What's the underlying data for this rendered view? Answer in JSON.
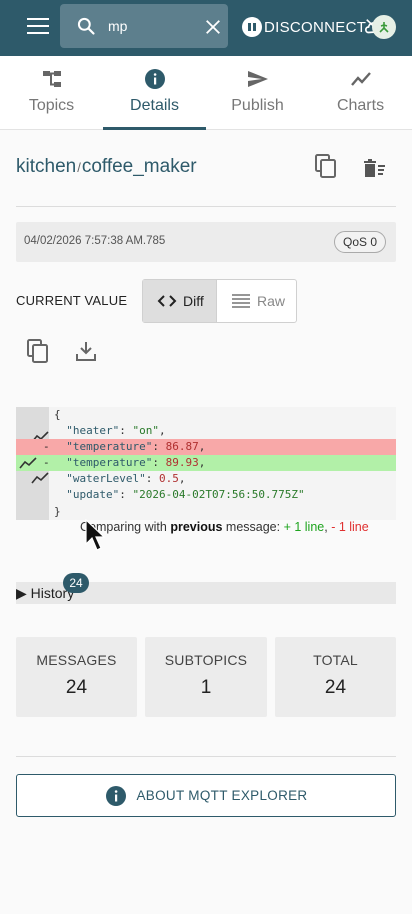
{
  "appbar": {
    "search_value": "mp",
    "disconnect_label": "DISCONNECT"
  },
  "tabs": [
    {
      "label": "Topics",
      "icon": "topics-tree-icon"
    },
    {
      "label": "Details",
      "icon": "info-icon",
      "active": true
    },
    {
      "label": "Publish",
      "icon": "send-icon"
    },
    {
      "label": "Charts",
      "icon": "chart-line-icon"
    }
  ],
  "topic": {
    "parent": "kitchen",
    "separator": "/",
    "name": "coffee_maker"
  },
  "message": {
    "timestamp": "04/02/2026 7:57:38 AM.785",
    "qos": "QoS 0"
  },
  "value": {
    "label": "CURRENT VALUE",
    "diff_label": "Diff",
    "raw_label": "Raw",
    "open_brace": "{",
    "close_brace": "}",
    "lines": [
      {
        "key": "\"heater\"",
        "value": "\"on\"",
        "kind": "string",
        "trail": ","
      },
      {
        "key": "\"temperature\"",
        "value": "86.87",
        "kind": "number",
        "trail": ",",
        "change": "removed"
      },
      {
        "key": "\"temperature\"",
        "value": "89.93",
        "kind": "number",
        "trail": ",",
        "change": "added"
      },
      {
        "key": "\"waterLevel\"",
        "value": "0.5",
        "kind": "number",
        "trail": ","
      },
      {
        "key": "\"update\"",
        "value": "\"2026-04-02T07:56:50.775Z\"",
        "kind": "string",
        "trail": ""
      }
    ],
    "compare_prefix": "Comparing with ",
    "compare_bold": "previous",
    "compare_mid": " message: ",
    "added_text": "+ 1 line",
    "comma": ", ",
    "removed_text": "- 1 line"
  },
  "history": {
    "label": "▶ History",
    "count": "24"
  },
  "stats": [
    {
      "label": "MESSAGES",
      "value": "24"
    },
    {
      "label": "SUBTOPICS",
      "value": "1"
    },
    {
      "label": "TOTAL",
      "value": "24"
    }
  ],
  "about_label": "ABOUT MQTT EXPLORER",
  "colors": {
    "primary": "#2e5a6a",
    "diff_removed": "#f8a8a8",
    "diff_added": "#b2f0a8"
  }
}
